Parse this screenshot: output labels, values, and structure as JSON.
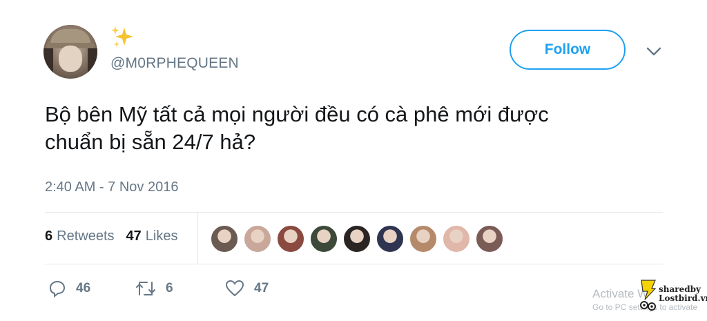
{
  "header": {
    "handle": "@M0RPHEQUEEN",
    "follow_label": "Follow",
    "emoji": "✨"
  },
  "tweet": {
    "line1": "Bộ bên Mỹ tất cả mọi người đều có cà phê mới được",
    "line2": "chuẩn bị sẵn 24/7 hả?",
    "timestamp": "2:40 AM - 7 Nov 2016"
  },
  "stats": {
    "retweets_count": "6",
    "retweets_label": "Retweets",
    "likes_count": "47",
    "likes_label": "Likes",
    "liker_avatars": [
      "#6b5a52",
      "#c9a79a",
      "#8a4a3f",
      "#3d4a3a",
      "#2a2523",
      "#2f3550",
      "#b58a6a",
      "#e0b7a8",
      "#7a5b55"
    ]
  },
  "actions": {
    "reply_count": "46",
    "retweet_count": "6",
    "like_count": "47"
  },
  "watermark": {
    "line1": "Activate W",
    "line2": "Go to PC settings to activate",
    "logo_text_1": "sharedby",
    "logo_text_2": "Lostbird.vn"
  },
  "colors": {
    "accent": "#1da1f2",
    "muted": "#657786",
    "text": "#14171a"
  }
}
